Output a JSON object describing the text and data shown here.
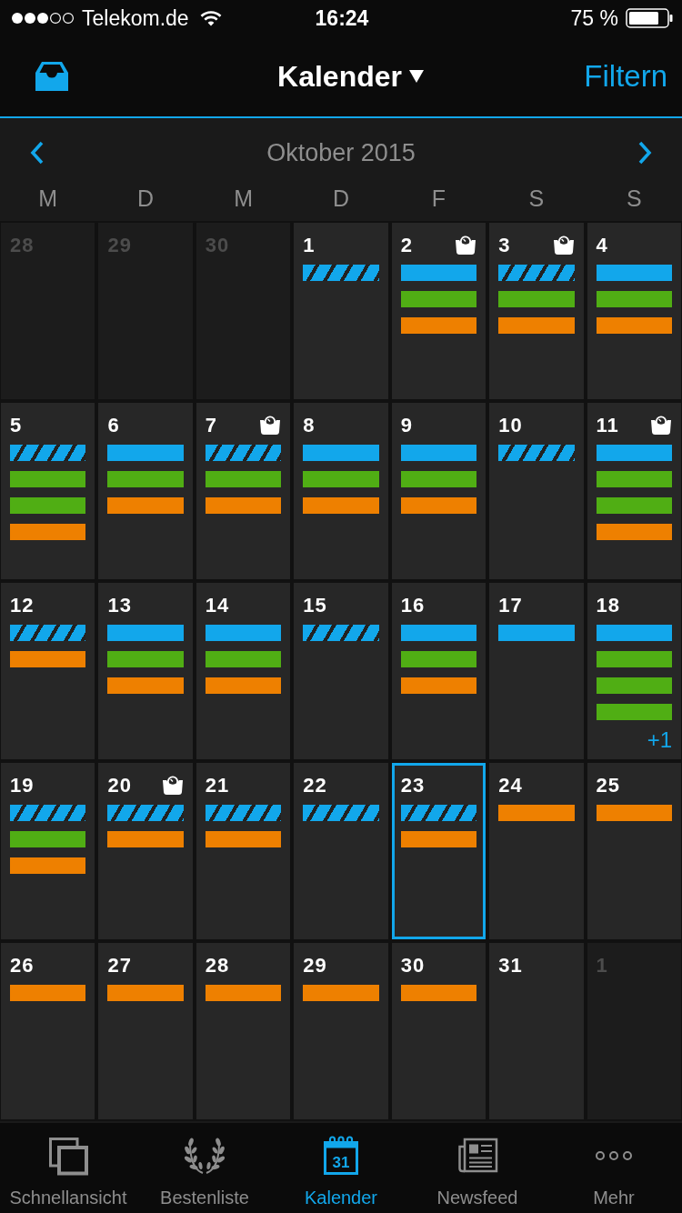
{
  "status_bar": {
    "carrier": "Telekom.de",
    "time": "16:24",
    "battery": "75 %"
  },
  "nav_bar": {
    "title": "Kalender",
    "action": "Filtern"
  },
  "month_header": {
    "title": "Oktober 2015",
    "weekdays": [
      "M",
      "D",
      "M",
      "D",
      "F",
      "S",
      "S"
    ]
  },
  "calendar": {
    "weeks": [
      {
        "days": [
          {
            "day": "28",
            "in_month": false,
            "selected": false,
            "weigh_in": false
          },
          {
            "day": "29",
            "in_month": false,
            "selected": false,
            "weigh_in": false
          },
          {
            "day": "30",
            "in_month": false,
            "selected": false,
            "weigh_in": false
          },
          {
            "day": "1",
            "in_month": true,
            "selected": false,
            "weigh_in": false,
            "entries": [
              {
                "kind": "striped",
                "color": "#12a7eb"
              }
            ]
          },
          {
            "day": "2",
            "in_month": true,
            "selected": false,
            "weigh_in": true,
            "entries": [
              {
                "kind": "solid",
                "color": "#12a7eb"
              },
              {
                "kind": "solid",
                "color": "#50ae14"
              },
              {
                "kind": "solid",
                "color": "#ee8000"
              }
            ]
          },
          {
            "day": "3",
            "in_month": true,
            "selected": false,
            "weigh_in": true,
            "entries": [
              {
                "kind": "striped",
                "color": "#12a7eb"
              },
              {
                "kind": "solid",
                "color": "#50ae14"
              },
              {
                "kind": "solid",
                "color": "#ee8000"
              }
            ]
          },
          {
            "day": "4",
            "in_month": true,
            "selected": false,
            "weigh_in": false,
            "entries": [
              {
                "kind": "solid",
                "color": "#12a7eb"
              },
              {
                "kind": "solid",
                "color": "#50ae14"
              },
              {
                "kind": "solid",
                "color": "#ee8000"
              }
            ]
          }
        ]
      },
      {
        "days": [
          {
            "day": "5",
            "in_month": true,
            "selected": false,
            "weigh_in": false,
            "entries": [
              {
                "kind": "striped",
                "color": "#12a7eb"
              },
              {
                "kind": "solid",
                "color": "#50ae14"
              },
              {
                "kind": "solid",
                "color": "#50ae14"
              },
              {
                "kind": "solid",
                "color": "#ee8000"
              }
            ]
          },
          {
            "day": "6",
            "in_month": true,
            "selected": false,
            "weigh_in": false,
            "entries": [
              {
                "kind": "solid",
                "color": "#12a7eb"
              },
              {
                "kind": "solid",
                "color": "#50ae14"
              },
              {
                "kind": "solid",
                "color": "#ee8000"
              }
            ]
          },
          {
            "day": "7",
            "in_month": true,
            "selected": false,
            "weigh_in": true,
            "entries": [
              {
                "kind": "striped",
                "color": "#12a7eb"
              },
              {
                "kind": "solid",
                "color": "#50ae14"
              },
              {
                "kind": "solid",
                "color": "#ee8000"
              }
            ]
          },
          {
            "day": "8",
            "in_month": true,
            "selected": false,
            "weigh_in": false,
            "entries": [
              {
                "kind": "solid",
                "color": "#12a7eb"
              },
              {
                "kind": "solid",
                "color": "#50ae14"
              },
              {
                "kind": "solid",
                "color": "#ee8000"
              }
            ]
          },
          {
            "day": "9",
            "in_month": true,
            "selected": false,
            "weigh_in": false,
            "entries": [
              {
                "kind": "solid",
                "color": "#12a7eb"
              },
              {
                "kind": "solid",
                "color": "#50ae14"
              },
              {
                "kind": "solid",
                "color": "#ee8000"
              }
            ]
          },
          {
            "day": "10",
            "in_month": true,
            "selected": false,
            "weigh_in": false,
            "entries": [
              {
                "kind": "striped",
                "color": "#12a7eb"
              }
            ]
          },
          {
            "day": "11",
            "in_month": true,
            "selected": false,
            "weigh_in": true,
            "entries": [
              {
                "kind": "solid",
                "color": "#12a7eb"
              },
              {
                "kind": "solid",
                "color": "#50ae14"
              },
              {
                "kind": "solid",
                "color": "#50ae14"
              },
              {
                "kind": "solid",
                "color": "#ee8000"
              }
            ]
          }
        ]
      },
      {
        "days": [
          {
            "day": "12",
            "in_month": true,
            "selected": false,
            "weigh_in": false,
            "entries": [
              {
                "kind": "striped",
                "color": "#12a7eb"
              },
              {
                "kind": "solid",
                "color": "#ee8000"
              }
            ]
          },
          {
            "day": "13",
            "in_month": true,
            "selected": false,
            "weigh_in": false,
            "entries": [
              {
                "kind": "solid",
                "color": "#12a7eb"
              },
              {
                "kind": "solid",
                "color": "#50ae14"
              },
              {
                "kind": "solid",
                "color": "#ee8000"
              }
            ]
          },
          {
            "day": "14",
            "in_month": true,
            "selected": false,
            "weigh_in": false,
            "entries": [
              {
                "kind": "solid",
                "color": "#12a7eb"
              },
              {
                "kind": "solid",
                "color": "#50ae14"
              },
              {
                "kind": "solid",
                "color": "#ee8000"
              }
            ]
          },
          {
            "day": "15",
            "in_month": true,
            "selected": false,
            "weigh_in": false,
            "entries": [
              {
                "kind": "striped",
                "color": "#12a7eb"
              }
            ]
          },
          {
            "day": "16",
            "in_month": true,
            "selected": false,
            "weigh_in": false,
            "entries": [
              {
                "kind": "solid",
                "color": "#12a7eb"
              },
              {
                "kind": "solid",
                "color": "#50ae14"
              },
              {
                "kind": "solid",
                "color": "#ee8000"
              }
            ]
          },
          {
            "day": "17",
            "in_month": true,
            "selected": false,
            "weigh_in": false,
            "entries": [
              {
                "kind": "solid",
                "color": "#12a7eb"
              }
            ]
          },
          {
            "day": "18",
            "in_month": true,
            "selected": false,
            "weigh_in": false,
            "entries": [
              {
                "kind": "solid",
                "color": "#12a7eb"
              },
              {
                "kind": "solid",
                "color": "#50ae14"
              },
              {
                "kind": "solid",
                "color": "#50ae14"
              },
              {
                "kind": "solid",
                "color": "#50ae14"
              }
            ],
            "more": "+1"
          }
        ]
      },
      {
        "days": [
          {
            "day": "19",
            "in_month": true,
            "selected": false,
            "weigh_in": false,
            "entries": [
              {
                "kind": "striped",
                "color": "#12a7eb"
              },
              {
                "kind": "solid",
                "color": "#50ae14"
              },
              {
                "kind": "solid",
                "color": "#ee8000"
              }
            ]
          },
          {
            "day": "20",
            "in_month": true,
            "selected": false,
            "weigh_in": true,
            "entries": [
              {
                "kind": "striped",
                "color": "#12a7eb"
              },
              {
                "kind": "solid",
                "color": "#ee8000"
              }
            ]
          },
          {
            "day": "21",
            "in_month": true,
            "selected": false,
            "weigh_in": false,
            "entries": [
              {
                "kind": "striped",
                "color": "#12a7eb"
              },
              {
                "kind": "solid",
                "color": "#ee8000"
              }
            ]
          },
          {
            "day": "22",
            "in_month": true,
            "selected": false,
            "weigh_in": false,
            "entries": [
              {
                "kind": "striped",
                "color": "#12a7eb"
              }
            ]
          },
          {
            "day": "23",
            "in_month": true,
            "selected": true,
            "weigh_in": false,
            "entries": [
              {
                "kind": "striped",
                "color": "#12a7eb"
              },
              {
                "kind": "solid",
                "color": "#ee8000"
              }
            ]
          },
          {
            "day": "24",
            "in_month": true,
            "selected": false,
            "weigh_in": false,
            "entries": [
              {
                "kind": "solid",
                "color": "#ee8000"
              }
            ]
          },
          {
            "day": "25",
            "in_month": true,
            "selected": false,
            "weigh_in": false,
            "entries": [
              {
                "kind": "solid",
                "color": "#ee8000"
              }
            ]
          }
        ]
      },
      {
        "days": [
          {
            "day": "26",
            "in_month": true,
            "selected": false,
            "weigh_in": false,
            "entries": [
              {
                "kind": "solid",
                "color": "#ee8000"
              }
            ]
          },
          {
            "day": "27",
            "in_month": true,
            "selected": false,
            "weigh_in": false,
            "entries": [
              {
                "kind": "solid",
                "color": "#ee8000"
              }
            ]
          },
          {
            "day": "28",
            "in_month": true,
            "selected": false,
            "weigh_in": false,
            "entries": [
              {
                "kind": "solid",
                "color": "#ee8000"
              }
            ]
          },
          {
            "day": "29",
            "in_month": true,
            "selected": false,
            "weigh_in": false,
            "entries": [
              {
                "kind": "solid",
                "color": "#ee8000"
              }
            ]
          },
          {
            "day": "30",
            "in_month": true,
            "selected": false,
            "weigh_in": false,
            "entries": [
              {
                "kind": "solid",
                "color": "#ee8000"
              }
            ]
          },
          {
            "day": "31",
            "in_month": true,
            "selected": false,
            "weigh_in": false
          },
          {
            "day": "1",
            "in_month": false,
            "selected": false,
            "weigh_in": false
          }
        ]
      }
    ]
  },
  "tab_bar": {
    "tabs": [
      {
        "label": "Schnellansicht",
        "kind": "stack",
        "selected": false
      },
      {
        "label": "Bestenliste",
        "kind": "laurel",
        "selected": false
      },
      {
        "label": "Kalender",
        "kind": "calendar",
        "icon_text": "31",
        "selected": true
      },
      {
        "label": "Newsfeed",
        "kind": "news",
        "selected": false
      },
      {
        "label": "Mehr",
        "kind": "more",
        "selected": false
      }
    ]
  }
}
